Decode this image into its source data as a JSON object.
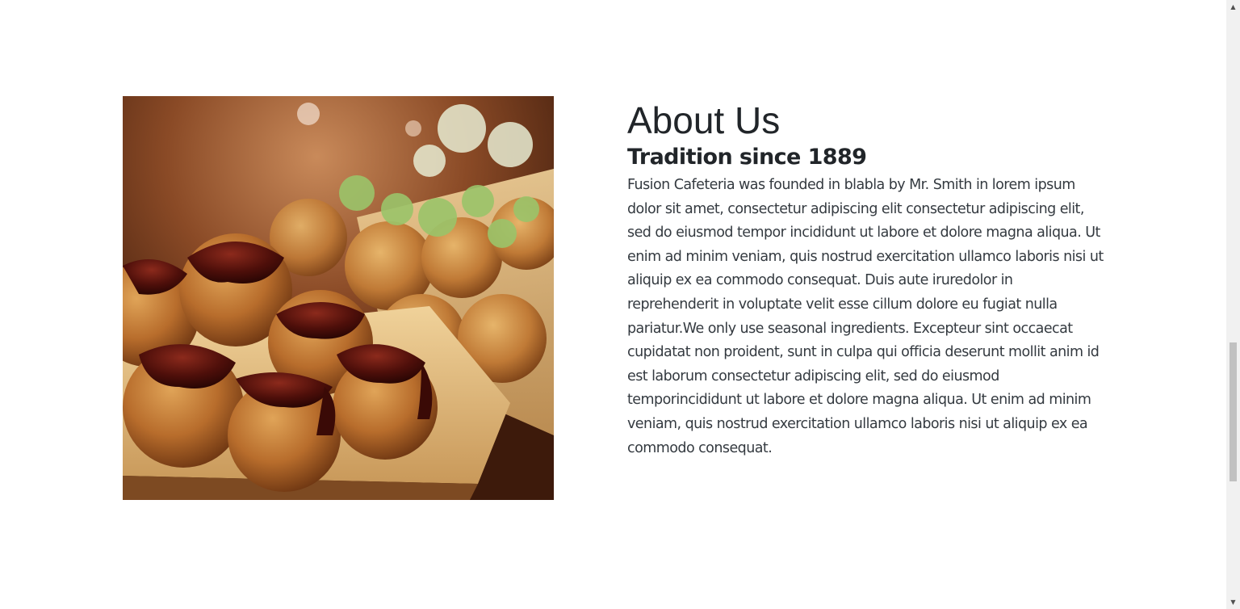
{
  "about": {
    "title": "About Us",
    "subtitle": "Tradition since 1889",
    "body": "Fusion Cafeteria was founded in blabla by Mr. Smith in lorem ipsum dolor sit amet, consectetur adipiscing elit consectetur adipiscing elit, sed do eiusmod tempor incididunt ut labore et dolore magna aliqua. Ut enim ad minim veniam, quis nostrud exercitation ullamco laboris nisi ut aliquip ex ea commodo consequat. Duis aute iruredolor in reprehenderit in voluptate velit esse cillum dolore eu fugiat nulla pariatur.We only use seasonal ingredients. Excepteur sint occaecat cupidatat non proident, sunt in culpa qui officia deserunt mollit anim id est laborum consectetur adipiscing elit, sed do eiusmod temporincididunt ut labore et dolore magna aliqua. Ut enim ad minim veniam, quis nostrud exercitation ullamco laboris nisi ut aliquip ex ea commodo consequat."
  },
  "image": {
    "subject": "takoyaki-food-photo"
  },
  "scrollbar": {
    "up_icon": "▲",
    "down_icon": "▼",
    "position": 0.56
  }
}
